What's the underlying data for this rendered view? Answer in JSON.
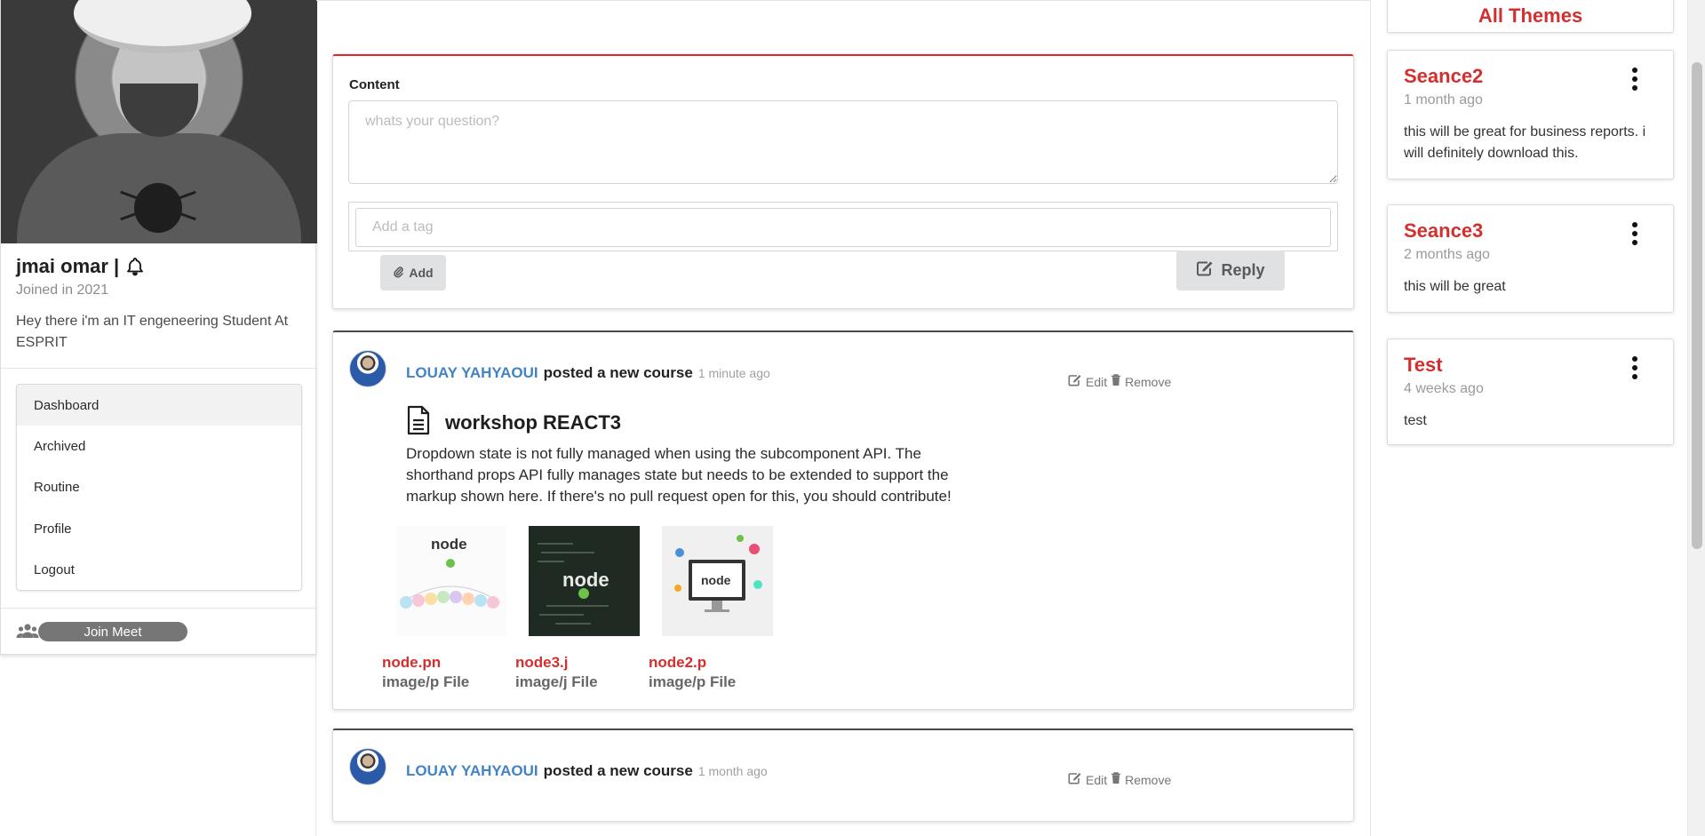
{
  "profile": {
    "name": "jmai omar |",
    "joined": "Joined in 2021",
    "bio": "Hey there i'm an IT engeneering Student At ESPRIT",
    "menu": [
      {
        "label": "Dashboard",
        "active": true
      },
      {
        "label": "Archived",
        "active": false
      },
      {
        "label": "Routine",
        "active": false
      },
      {
        "label": "Profile",
        "active": false
      },
      {
        "label": "Logout",
        "active": false
      }
    ],
    "meet_button": "Join Meet"
  },
  "composer": {
    "content_label": "Content",
    "question_placeholder": "whats your question?",
    "tag_placeholder": "Add a tag",
    "add_label": "Add",
    "reply_label": "Reply"
  },
  "feed": [
    {
      "author": "LOUAY YAHYAOUI",
      "action": "posted a new course",
      "time": "1 minute ago",
      "edit_label": "Edit",
      "remove_label": "Remove",
      "course_title": "workshop REACT3",
      "description": "Dropdown state is not fully managed when using the subcomponent API. The shorthand props API fully manages state but needs to be extended to support the markup shown here. If there's no pull request open for this, you should contribute!",
      "files": [
        {
          "name": "node.pn",
          "type": "image/p File"
        },
        {
          "name": "node3.j",
          "type": "image/j File"
        },
        {
          "name": "node2.p",
          "type": "image/p File"
        }
      ]
    },
    {
      "author": "LOUAY YAHYAOUI",
      "action": "posted a new course",
      "time": "1 month ago",
      "edit_label": "Edit",
      "remove_label": "Remove"
    }
  ],
  "themes": {
    "header": "All Themes",
    "items": [
      {
        "title": "Seance2",
        "time": "1 month ago",
        "text": "this will be great for business reports. i will definitely download this."
      },
      {
        "title": "Seance3",
        "time": "2 months ago",
        "text": "this will be great"
      },
      {
        "title": "Test",
        "time": "4 weeks ago",
        "text": "test"
      }
    ]
  },
  "colors": {
    "accent_red": "#db2828",
    "link_blue": "#4183c4",
    "button_gray": "#e0e1e2"
  }
}
